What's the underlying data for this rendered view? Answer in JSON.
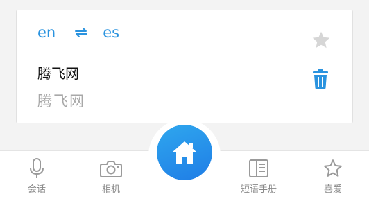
{
  "card": {
    "source_lang": "en",
    "target_lang": "es",
    "source_text": "腾飞网",
    "translated_text": "腾飞网"
  },
  "nav": {
    "items": [
      {
        "label": "会话",
        "icon": "microphone-icon"
      },
      {
        "label": "相机",
        "icon": "camera-icon"
      },
      {
        "label": "",
        "icon": "home-icon"
      },
      {
        "label": "短语手册",
        "icon": "phrasebook-icon"
      },
      {
        "label": "喜爱",
        "icon": "star-outline-icon"
      }
    ]
  },
  "colors": {
    "accent": "#2a93df",
    "star_inactive": "#d6d6d6",
    "nav_icon": "#9a9a9a",
    "home_gradient_start": "#2fa7ee",
    "home_gradient_end": "#1f7de6"
  }
}
